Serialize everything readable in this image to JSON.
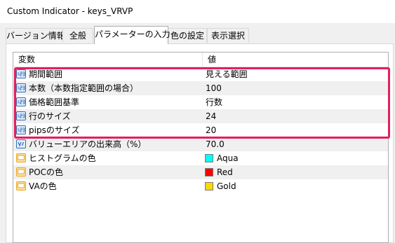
{
  "window": {
    "title": "Custom Indicator - keys_VRVP"
  },
  "tabs": [
    {
      "label": "バージョン情報",
      "active": false
    },
    {
      "label": "全般",
      "active": false
    },
    {
      "label": "パラメーターの入力",
      "active": true
    },
    {
      "label": "色の設定",
      "active": false
    },
    {
      "label": "表示選択",
      "active": false
    }
  ],
  "grid": {
    "columns": {
      "variable": "変数",
      "value": "値"
    },
    "rows": [
      {
        "name": "期間範囲",
        "value": "見える範囲",
        "type": "int-icon"
      },
      {
        "name": "本数（本数指定範囲の場合）",
        "value": "100",
        "type": "int-icon"
      },
      {
        "name": "価格範囲基準",
        "value": "行数",
        "type": "int-icon"
      },
      {
        "name": "行のサイズ",
        "value": "24",
        "type": "int-icon"
      },
      {
        "name": "pipsのサイズ",
        "value": "20",
        "type": "int-icon"
      },
      {
        "name": "バリューエリアの出来高（%）",
        "value": "70.0",
        "type": "double-icon"
      },
      {
        "name": "ヒストグラムの色",
        "value": "Aqua",
        "type": "color-icon",
        "color": "#00ffff"
      },
      {
        "name": "POCの色",
        "value": "Red",
        "type": "color-icon",
        "color": "#ff0000"
      },
      {
        "name": "VAの色",
        "value": "Gold",
        "type": "color-icon",
        "color": "#ffd700"
      }
    ]
  },
  "colors": {
    "highlight_border": "#e51e5e",
    "alt_row": "#f0f0f0",
    "int_icon": "#2f6fb7",
    "double_icon": "#2f6fb7",
    "color_icon": "#e8a21a"
  }
}
